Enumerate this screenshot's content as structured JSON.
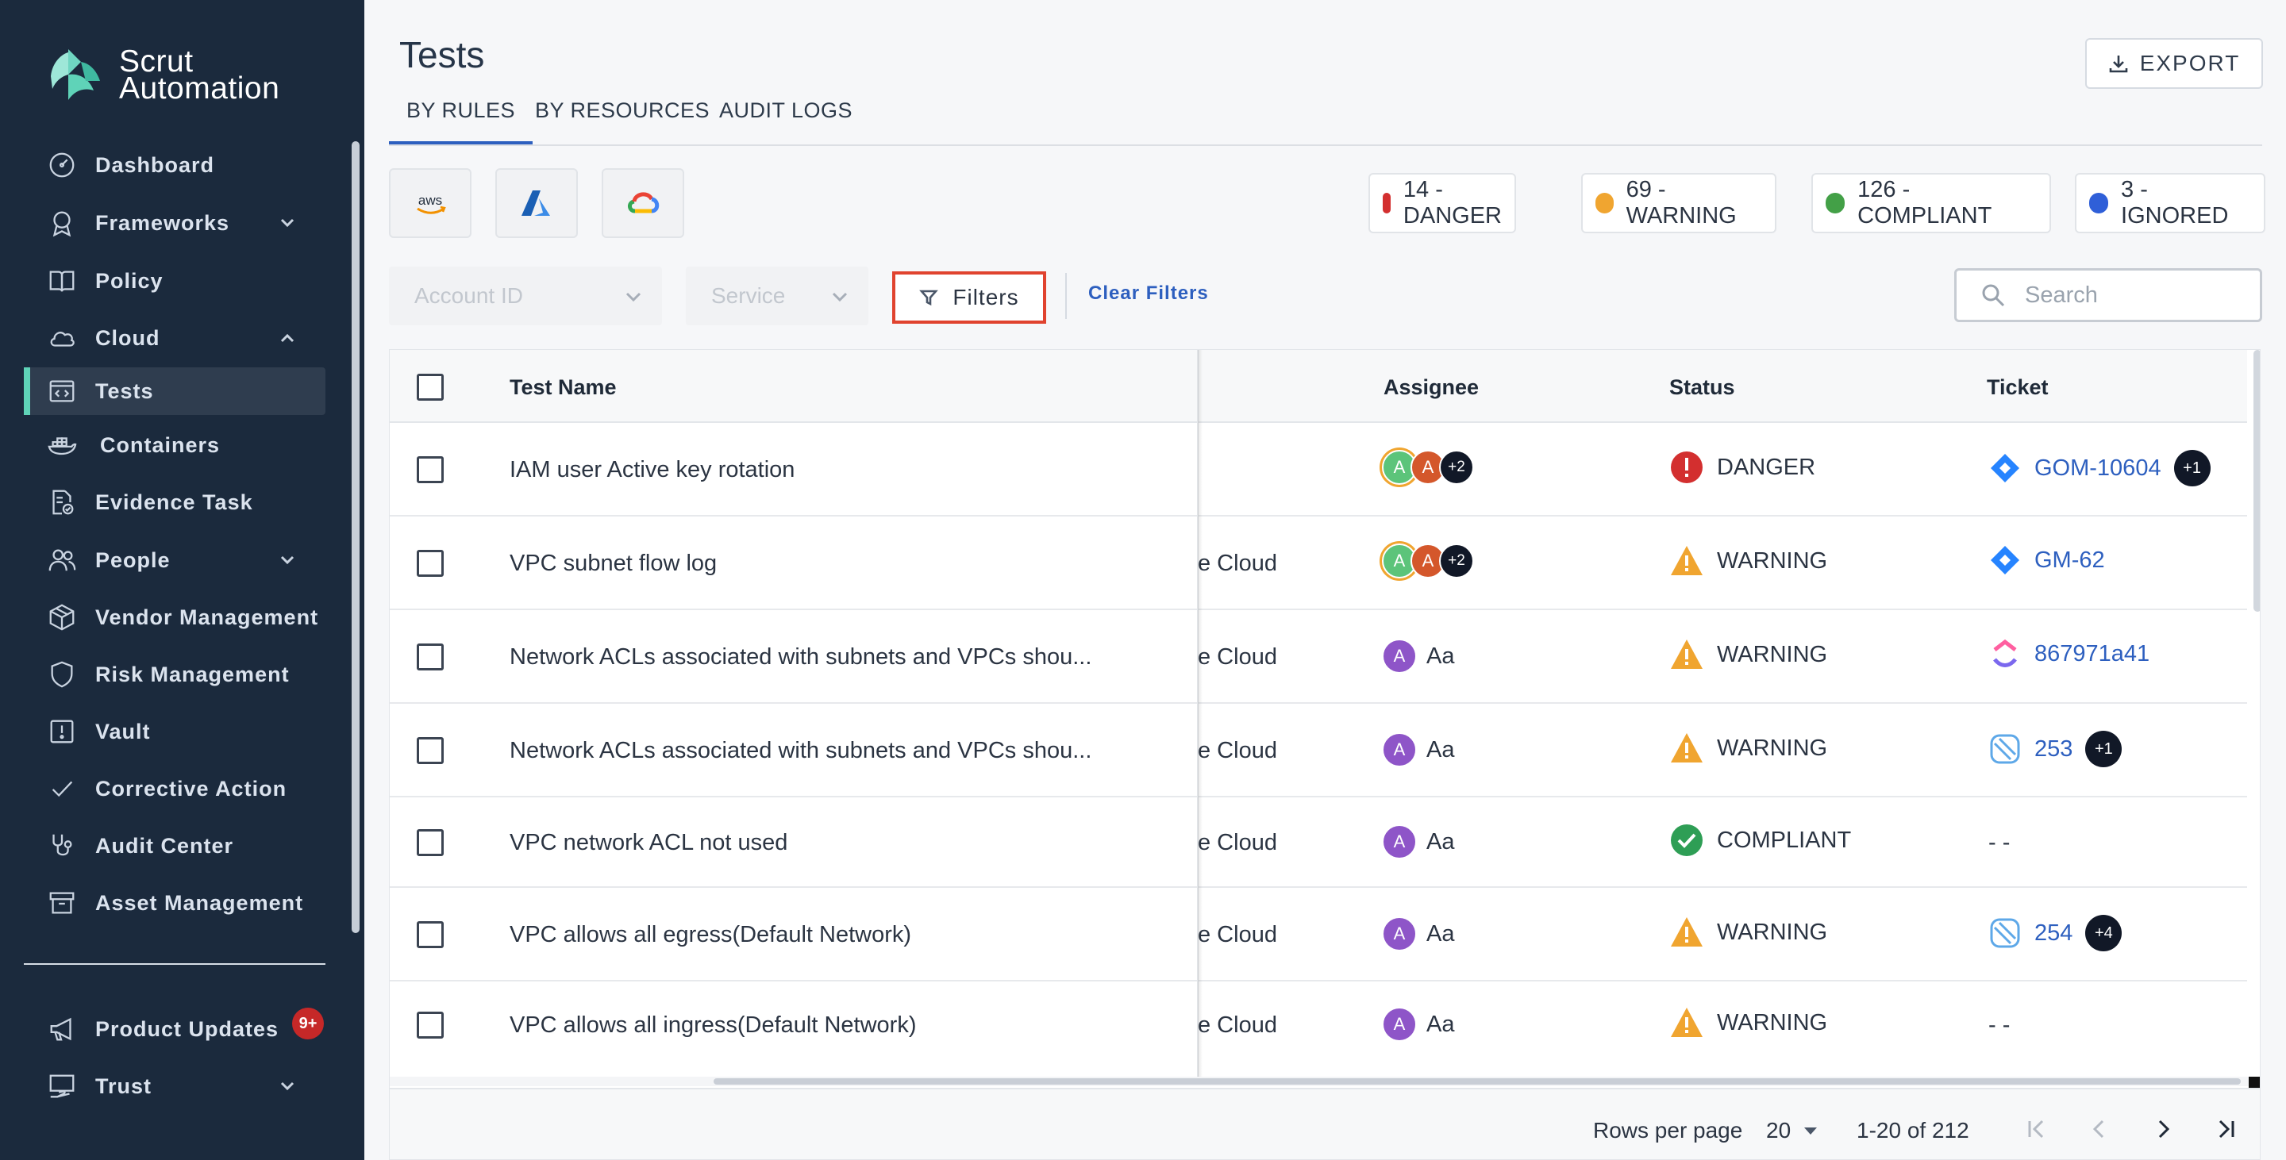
{
  "sidebar": {
    "brand_line1": "Scrut",
    "brand_line2": "Automation",
    "items": [
      {
        "label": "Dashboard"
      },
      {
        "label": "Frameworks"
      },
      {
        "label": "Policy"
      },
      {
        "label": "Cloud"
      },
      {
        "label": "Tests"
      },
      {
        "label": "Containers"
      },
      {
        "label": "Evidence Task"
      },
      {
        "label": "People"
      },
      {
        "label": "Vendor Management"
      },
      {
        "label": "Risk Management"
      },
      {
        "label": "Vault"
      },
      {
        "label": "Corrective Action"
      },
      {
        "label": "Audit Center"
      },
      {
        "label": "Asset Management"
      },
      {
        "label": "Product Updates"
      },
      {
        "label": "Trust"
      }
    ],
    "updates_badge": "9+",
    "colors": {
      "bg": "#1b2a3d",
      "active_bg": "#2f3d4f",
      "accent": "#5fd3b8"
    }
  },
  "header": {
    "title": "Tests",
    "export_label": "EXPORT",
    "tabs": [
      {
        "label": "BY RULES",
        "active": true
      },
      {
        "label": "BY RESOURCES",
        "active": false
      },
      {
        "label": "AUDIT LOGS",
        "active": false
      }
    ]
  },
  "providers": [
    {
      "name": "aws",
      "label": "aws"
    },
    {
      "name": "azure",
      "label": ""
    },
    {
      "name": "gcp",
      "label": ""
    }
  ],
  "summary": [
    {
      "label": "14 - DANGER",
      "color": "#d32f2f"
    },
    {
      "label": "69 - WARNING",
      "color": "#f0a530"
    },
    {
      "label": "126 - COMPLIANT",
      "color": "#43a047"
    },
    {
      "label": "3 - IGNORED",
      "color": "#2f5fd8"
    }
  ],
  "filters": {
    "account_placeholder": "Account ID",
    "service_placeholder": "Service",
    "filters_label": "Filters",
    "clear_label": "Clear Filters",
    "search_placeholder": "Search"
  },
  "table": {
    "columns": {
      "name": "Test Name",
      "assignee": "Assignee",
      "status": "Status",
      "ticket": "Ticket"
    },
    "rows": [
      {
        "name": "IAM user Active key rotation",
        "service": "",
        "assignee_type": "group",
        "assignee_more": "+2",
        "status": "DANGER",
        "ticket": "GOM-10604",
        "ticket_icon": "jira",
        "ticket_more": "+1"
      },
      {
        "name": "VPC subnet flow log",
        "service": "e Cloud",
        "assignee_type": "group",
        "assignee_more": "+2",
        "status": "WARNING",
        "ticket": "GM-62",
        "ticket_icon": "jira",
        "ticket_more": ""
      },
      {
        "name": "Network ACLs associated with subnets and VPCs shou...",
        "service": "e Cloud",
        "assignee_type": "single",
        "assignee_name": "Aa",
        "status": "WARNING",
        "ticket": "867971a41",
        "ticket_icon": "clickup",
        "ticket_more": ""
      },
      {
        "name": "Network ACLs associated with subnets and VPCs shou...",
        "service": "e Cloud",
        "assignee_type": "single",
        "assignee_name": "Aa",
        "status": "WARNING",
        "ticket": "253",
        "ticket_icon": "linear",
        "ticket_more": "+1"
      },
      {
        "name": "VPC network ACL not used",
        "service": "e Cloud",
        "assignee_type": "single",
        "assignee_name": "Aa",
        "status": "COMPLIANT",
        "ticket": "- -",
        "ticket_icon": "",
        "ticket_more": ""
      },
      {
        "name": "VPC allows all egress(Default Network)",
        "service": "e Cloud",
        "assignee_type": "single",
        "assignee_name": "Aa",
        "status": "WARNING",
        "ticket": "254",
        "ticket_icon": "linear",
        "ticket_more": "+4"
      },
      {
        "name": "VPC allows all ingress(Default Network)",
        "service": "e Cloud",
        "assignee_type": "single",
        "assignee_name": "Aa",
        "status": "WARNING",
        "ticket": "- -",
        "ticket_icon": "",
        "ticket_more": ""
      }
    ],
    "avatar_letter": "A",
    "footer": {
      "rows_per_page_label": "Rows per page",
      "rows_per_page": "20",
      "range": "1-20 of 212"
    }
  }
}
